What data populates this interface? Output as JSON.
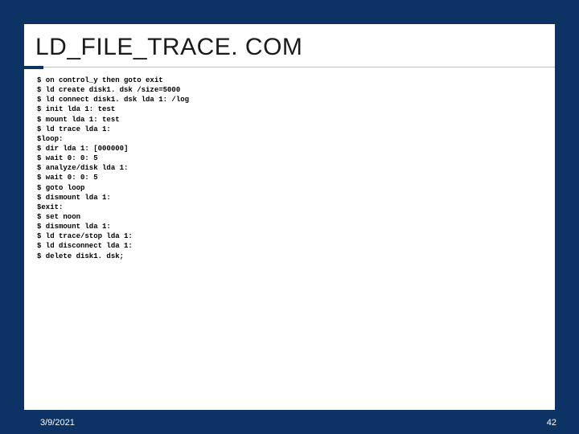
{
  "title": "LD_FILE_TRACE. COM",
  "code_lines": [
    "$ on control_y then goto exit",
    "$ ld create disk1. dsk /size=5000",
    "$ ld connect disk1. dsk lda 1: /log",
    "$ init lda 1: test",
    "$ mount lda 1: test",
    "$ ld trace lda 1:",
    "$loop:",
    "$ dir lda 1: [000000]",
    "$ wait 0: 0: 5",
    "$ analyze/disk lda 1:",
    "$ wait 0: 0: 5",
    "$ goto loop",
    "$ dismount lda 1:",
    "$exit:",
    "$ set noon",
    "$ dismount lda 1:",
    "$ ld trace/stop lda 1:",
    "$ ld disconnect lda 1:",
    "$ delete disk1. dsk;"
  ],
  "footer": {
    "date": "3/9/2021",
    "page": "42"
  }
}
